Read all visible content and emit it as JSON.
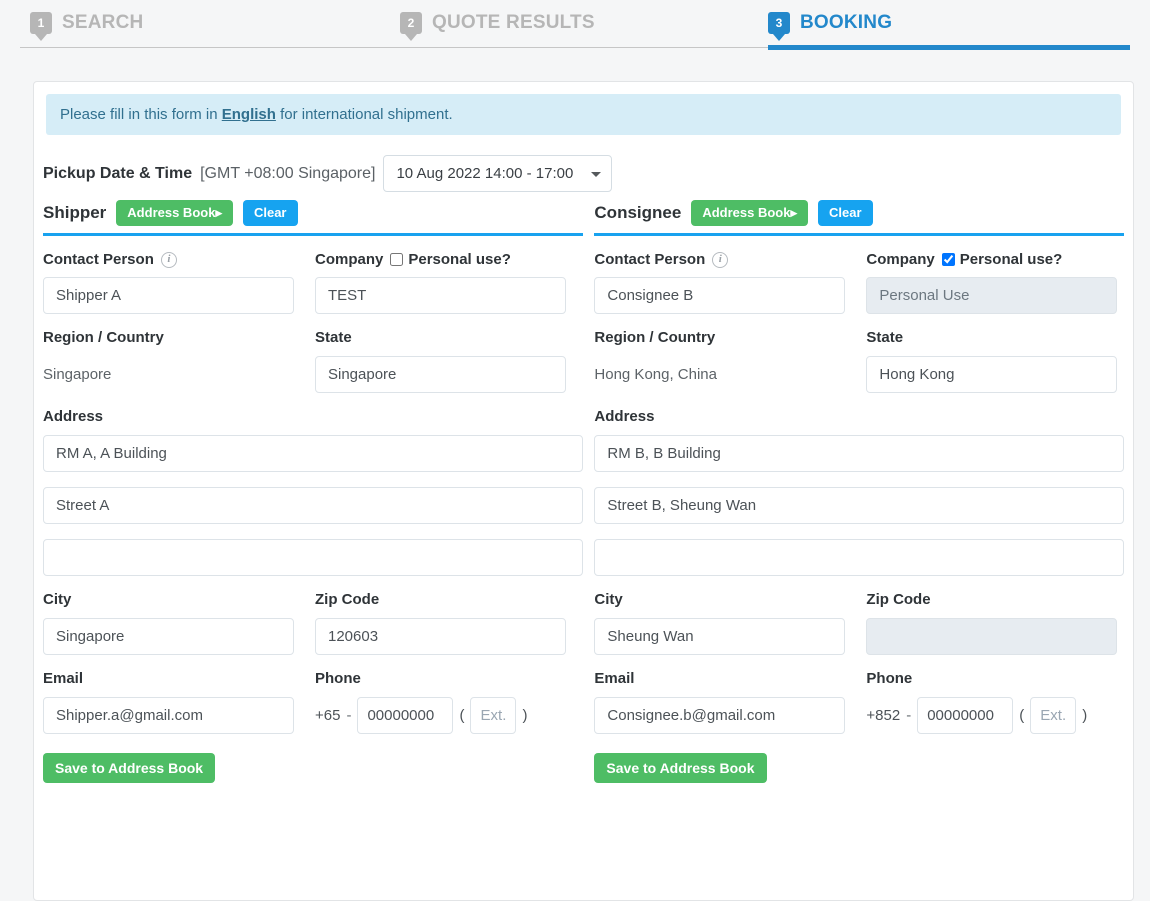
{
  "wizard": {
    "steps": [
      {
        "number": "1",
        "label": "SEARCH",
        "active": false
      },
      {
        "number": "2",
        "label": "QUOTE RESULTS",
        "active": false
      },
      {
        "number": "3",
        "label": "BOOKING",
        "active": true
      }
    ],
    "active_color": "#2388cb",
    "inactive_color": "#b6b6b6"
  },
  "notice": {
    "before": "Please fill in this form in ",
    "link": "English",
    "after": " for international shipment."
  },
  "pickup": {
    "label": "Pickup Date & Time",
    "timezone": "[GMT +08:00 Singapore]",
    "selected": "10 Aug 2022 14:00 - 17:00",
    "options": [
      "10 Aug 2022 14:00 - 17:00"
    ]
  },
  "labels": {
    "contact_person": "Contact Person",
    "company": "Company",
    "personal_use": "Personal use?",
    "region_country": "Region / Country",
    "state": "State",
    "address": "Address",
    "city": "City",
    "zip_code": "Zip Code",
    "email": "Email",
    "phone": "Phone",
    "address_book": "Address Book",
    "address_book_arrow": "▸",
    "clear": "Clear",
    "save_to_address_book": "Save to Address Book",
    "ext_placeholder": "Ext.",
    "info_glyph": "i",
    "dash": "-",
    "paren_open": "(",
    "paren_close": ")"
  },
  "shipper": {
    "title": "Shipper",
    "contact_person": "Shipper A",
    "company": "TEST",
    "company_disabled": false,
    "personal_use_checked": false,
    "region_country": "Singapore",
    "state": "Singapore",
    "address_line1": "RM A, A Building",
    "address_line2": "Street A",
    "address_line3": "",
    "city": "Singapore",
    "zip_code": "120603",
    "zip_disabled": false,
    "email": "Shipper.a@gmail.com",
    "phone_country_code": "+65",
    "phone_number": "00000000",
    "phone_ext": ""
  },
  "consignee": {
    "title": "Consignee",
    "contact_person": "Consignee B",
    "company": "Personal Use",
    "company_disabled": true,
    "personal_use_checked": true,
    "region_country": "Hong Kong, China",
    "state": "Hong Kong",
    "address_line1": "RM B, B Building",
    "address_line2": "Street B, Sheung Wan",
    "address_line3": "",
    "city": "Sheung Wan",
    "zip_code": "",
    "zip_disabled": true,
    "email": "Consignee.b@gmail.com",
    "phone_country_code": "+852",
    "phone_number": "00000000",
    "phone_ext": ""
  },
  "colors": {
    "accent_blue": "#2388cb",
    "rule_blue": "#18a2ef",
    "green": "#4ebd65",
    "light_blue": "#16a3f0",
    "notice_bg": "#d6edf7",
    "notice_text": "#31708f"
  }
}
